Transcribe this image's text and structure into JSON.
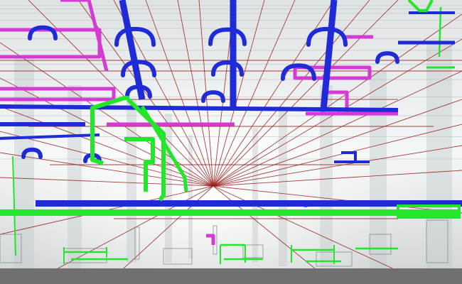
{
  "scene": {
    "colors": {
      "ceiling": "#e6eaea",
      "haze": "#f7fafa",
      "floor": "#6e6e6e",
      "sprinkler_pipe": "#1f2bd6",
      "duct_magenta": "#d43ad4",
      "pipe_green": "#22e62a",
      "electrical_red": "#9a1f1f",
      "column_gray": "#c4c9cb"
    },
    "system_icons": [
      "sprinkler-pipe-icon",
      "magenta-duct-icon",
      "green-pipe-icon",
      "electrical-conduit-icon"
    ]
  }
}
